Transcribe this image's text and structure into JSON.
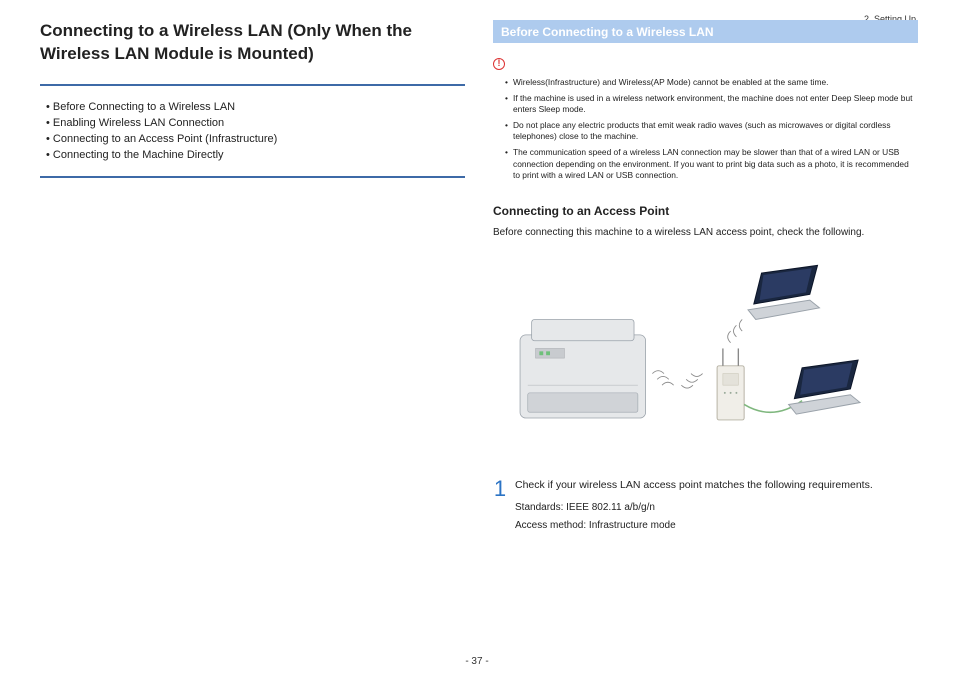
{
  "breadcrumb": "2. Setting Up",
  "page_number": "- 37 -",
  "left": {
    "title": "Connecting to a Wireless LAN (Only When the Wireless LAN Module is Mounted)",
    "toc": [
      "Before Connecting to a Wireless LAN",
      "Enabling Wireless LAN Connection",
      "Connecting to an Access Point (Infrastructure)",
      "Connecting to the Machine Directly"
    ]
  },
  "right": {
    "section_heading": "Before Connecting to a Wireless LAN",
    "alert_icon_label": "!",
    "notes": [
      "Wireless(Infrastructure) and Wireless(AP Mode) cannot be enabled at the same time.",
      "If the machine is used in a wireless network environment, the machine does not enter Deep Sleep mode but enters Sleep mode.",
      "Do not place any electric products that emit weak radio waves (such as microwaves or digital cordless telephones) close to the machine.",
      "The communication speed of a wireless LAN connection may be slower than that of a wired LAN or USB connection depending on the environment. If you want to print big data such as a photo, it is recommended to print with a wired LAN or USB connection."
    ],
    "sub_heading": "Connecting to an Access Point",
    "intro_text": "Before connecting this machine to a wireless LAN access point, check the following.",
    "step": {
      "number": "1",
      "text": "Check if your wireless LAN access point matches the following requirements.",
      "detail_standards": "Standards: IEEE 802.11 a/b/g/n",
      "detail_access": "Access method: Infrastructure mode"
    }
  }
}
